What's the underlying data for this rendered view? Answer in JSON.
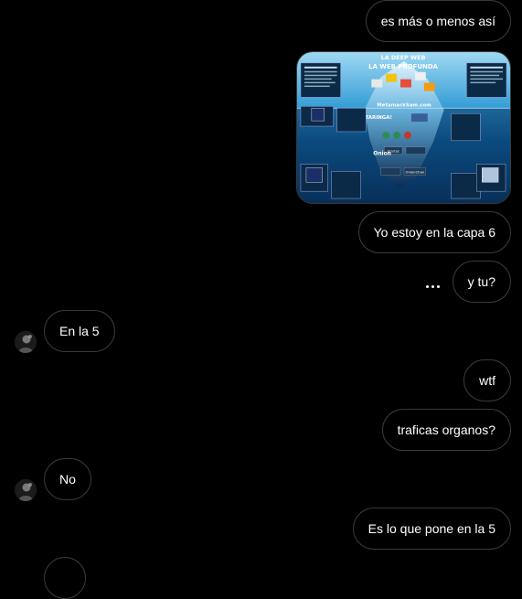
{
  "messages": {
    "m1": "es más o menos así",
    "m3": "Yo estoy en la capa 6",
    "m4": "y tu?",
    "m5": "En la 5",
    "m6": "wtf",
    "m7": "traficas organos?",
    "m8": "No",
    "m9": "Es lo que pone en la 5"
  },
  "image": {
    "title_line1": "LA DEEP WEB",
    "title_line2": "LA WEB PROFUNDA",
    "watermark": "MetamackSam.com",
    "label_taringa": "TARINGA!",
    "label_onion": "OnionChan",
    "label_onion2": "Onion",
    "label_ocultos": "Ocultos"
  },
  "icons": {
    "typing": "typing-indicator-icon",
    "avatar": "avatar-icon"
  },
  "colors": {
    "background": "#000000",
    "bubble_border": "#3a3a3a",
    "text": "#ffffff"
  }
}
